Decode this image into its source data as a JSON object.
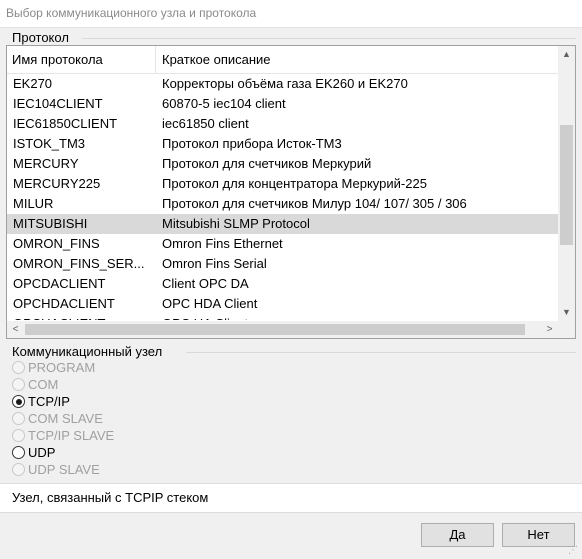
{
  "window": {
    "title": "Выбор коммуникационного узла и протокола"
  },
  "protocol_group": {
    "label": "Протокол",
    "columns": [
      "Имя протокола",
      "Краткое описание"
    ],
    "rows": [
      {
        "name": "EK270",
        "description": "Корректоры объёма газа EK260 и EK270",
        "selected": false
      },
      {
        "name": "IEC104CLIENT",
        "description": "60870-5 iec104 client",
        "selected": false
      },
      {
        "name": "IEC61850CLIENT",
        "description": "iec61850 client",
        "selected": false
      },
      {
        "name": "ISTOK_TM3",
        "description": "Протокол прибора Исток-ТМ3",
        "selected": false
      },
      {
        "name": "MERCURY",
        "description": "Протокол для счетчиков Меркурий",
        "selected": false
      },
      {
        "name": "MERCURY225",
        "description": "Протокол для концентратора Меркурий-225",
        "selected": false
      },
      {
        "name": "MILUR",
        "description": "Протокол для счетчиков Милур 104/ 107/ 305 / 306",
        "selected": false
      },
      {
        "name": "MITSUBISHI",
        "description": "Mitsubishi SLMP Protocol",
        "selected": true
      },
      {
        "name": "OMRON_FINS",
        "description": "Omron Fins Ethernet",
        "selected": false
      },
      {
        "name": "OMRON_FINS_SER...",
        "description": "Omron Fins Serial",
        "selected": false
      },
      {
        "name": "OPCDACLIENT",
        "description": "Client OPC DA",
        "selected": false
      },
      {
        "name": "OPCHDACLIENT",
        "description": "OPC HDA Client",
        "selected": false
      },
      {
        "name": "OPCUACLIENT",
        "description": "OPC UA Client",
        "selected": false
      }
    ]
  },
  "node_group": {
    "label": "Коммуникационный узел",
    "options": [
      {
        "label": "PROGRAM",
        "checked": false,
        "enabled": false
      },
      {
        "label": "COM",
        "checked": false,
        "enabled": false
      },
      {
        "label": "TCP/IP",
        "checked": true,
        "enabled": true
      },
      {
        "label": "COM SLAVE",
        "checked": false,
        "enabled": false
      },
      {
        "label": "TCP/IP SLAVE",
        "checked": false,
        "enabled": false
      },
      {
        "label": "UDP",
        "checked": false,
        "enabled": true
      },
      {
        "label": "UDP SLAVE",
        "checked": false,
        "enabled": false
      }
    ]
  },
  "status": {
    "text": "Узел, связанный с TCPIP стеком"
  },
  "buttons": {
    "ok_label": "Да",
    "cancel_label": "Нет"
  }
}
